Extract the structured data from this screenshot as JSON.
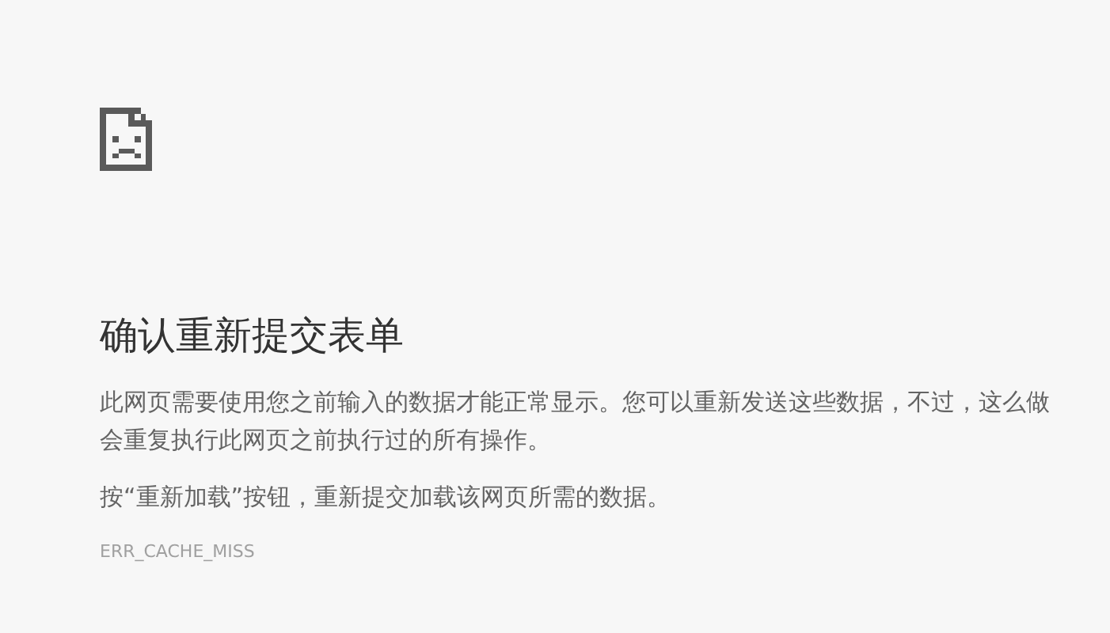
{
  "title": "确认重新提交表单",
  "paragraphs": [
    "此网页需要使用您之前输入的数据才能正常显示。您可以重新发送这些数据，不过，这么做会重复执行此网页之前执行过的所有操作。",
    "按“重新加载”按钮，重新提交加载该网页所需的数据。"
  ],
  "error_code": "ERR_CACHE_MISS"
}
